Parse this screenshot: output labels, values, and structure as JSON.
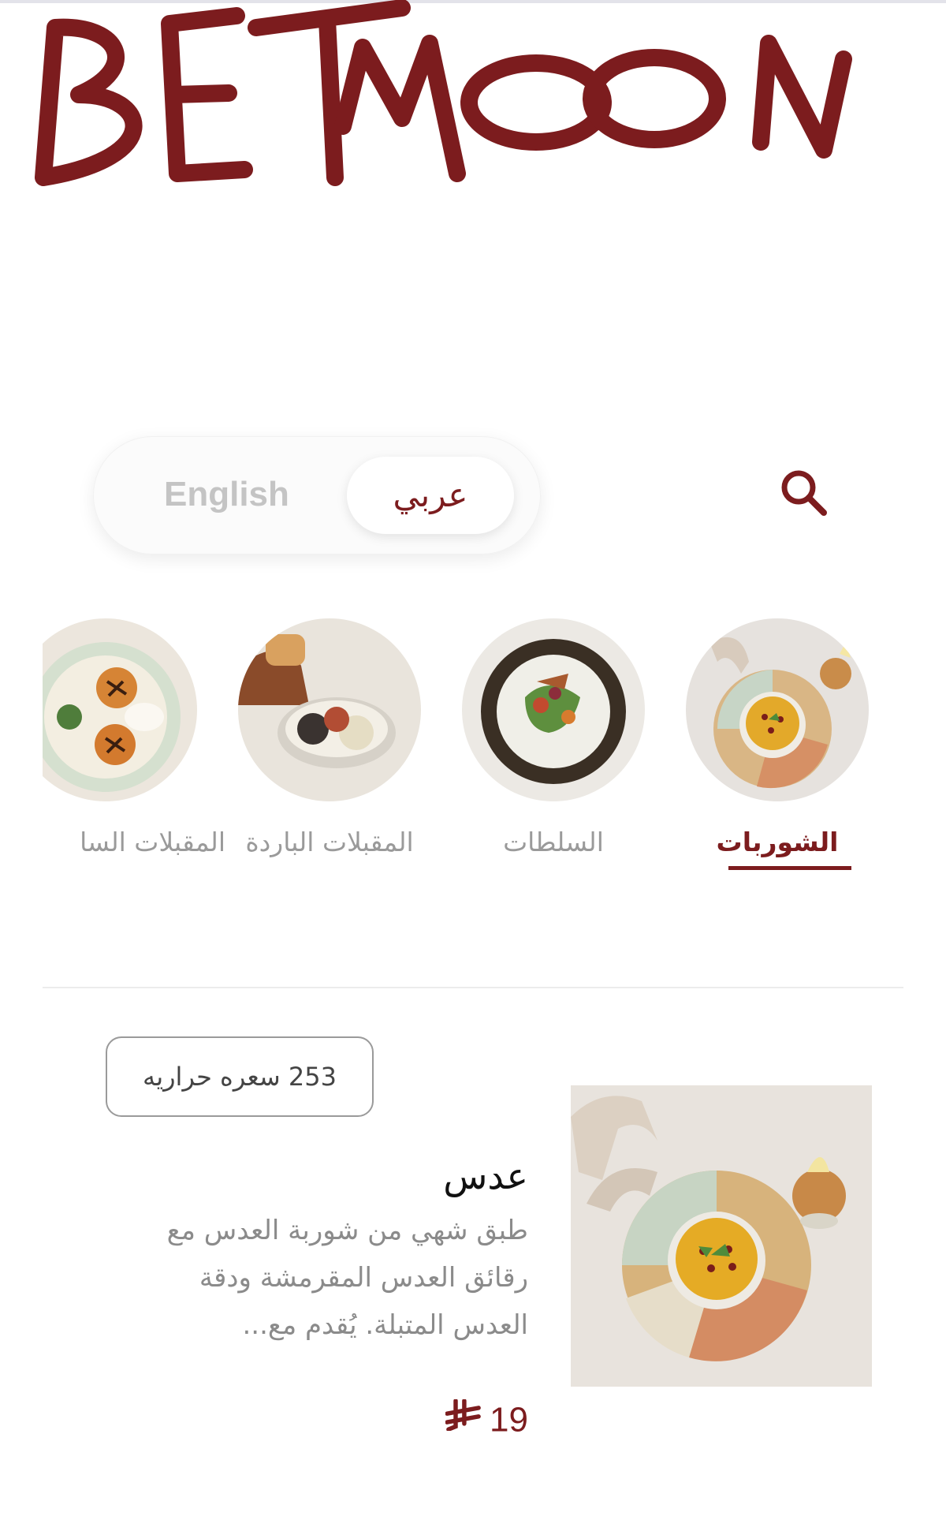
{
  "brand": {
    "logo_text": "BETMOON",
    "color": "#7c1c1e"
  },
  "language_toggle": {
    "english_label": "English",
    "arabic_label": "عربي",
    "selected": "عربي"
  },
  "search": {
    "icon": "search-icon"
  },
  "categories": [
    {
      "label": "الشوربات",
      "active": true
    },
    {
      "label": "السلطات",
      "active": false
    },
    {
      "label": "المقبلات الباردة",
      "active": false
    },
    {
      "label": "المقبلات السا",
      "active": false
    }
  ],
  "dish": {
    "calories_label": "253 سعره حراريه",
    "title": "عدس",
    "description": "طبق شهي من شوربة العدس مع رقائق العدس المقرمشة ودقة العدس المتبلة. يُقدم مع...",
    "price": "19",
    "currency_icon": "saudi-riyal-icon"
  }
}
